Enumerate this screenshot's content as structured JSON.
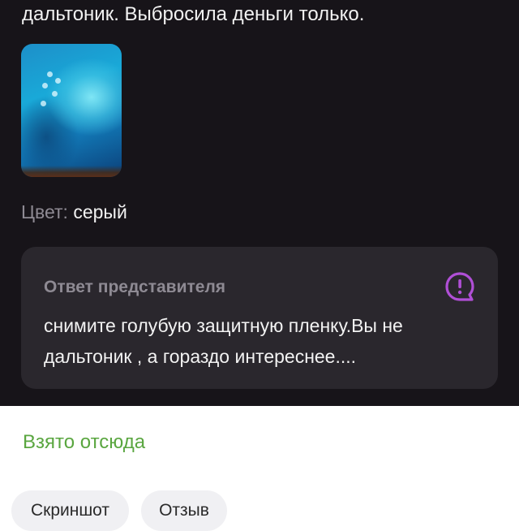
{
  "review": {
    "text": "дальтоник. Выбросила деньги только.",
    "color_label": "Цвет:",
    "color_value": "серый"
  },
  "answer": {
    "title": "Ответ представителя",
    "body": "снимите голубую защитную пленку.Вы не дальтоник , а гораздо интереснее....",
    "icon": "question-mark-speech-bubble-icon",
    "icon_color": "#b04fd6"
  },
  "footer": {
    "source_link": "Взято отсюда",
    "source_link_color": "#5aa640",
    "tags": [
      {
        "label": "Скриншот"
      },
      {
        "label": "Отзыв"
      }
    ]
  }
}
